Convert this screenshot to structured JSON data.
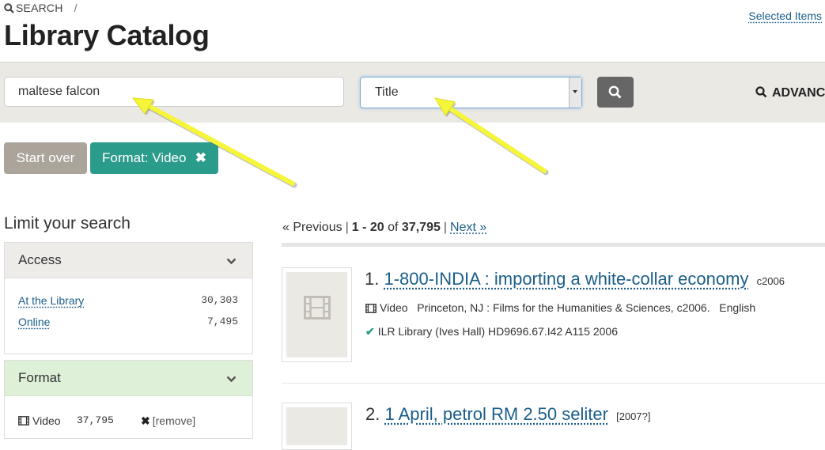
{
  "breadcrumb": {
    "search_label": "SEARCH",
    "separator": "/"
  },
  "header": {
    "selected_items": "Selected Items",
    "title": "Library Catalog"
  },
  "search": {
    "query": "maltese falcon",
    "field": "Title",
    "advanced_label": "ADVANC"
  },
  "constraints": {
    "start_over": "Start over",
    "format_chip": "Format: Video",
    "remove_glyph": "✖"
  },
  "sidebar": {
    "title": "Limit your search",
    "access": {
      "heading": "Access",
      "items": [
        {
          "label": "At the Library",
          "count": "30,303"
        },
        {
          "label": "Online",
          "count": "7,495"
        }
      ]
    },
    "format": {
      "heading": "Format",
      "items": [
        {
          "label": "Video",
          "count": "37,795",
          "remove": "[remove]"
        }
      ]
    }
  },
  "pager": {
    "previous": "« Previous",
    "range": "1 - 20",
    "of": "of",
    "total": "37,795",
    "next": "Next »"
  },
  "results": [
    {
      "number": "1.",
      "title": "1-800-INDIA : importing a white-collar economy",
      "year": "c2006",
      "format": "Video",
      "publisher": "Princeton, NJ : Films for the Humanities & Sciences, c2006.",
      "language": "English",
      "location": "ILR Library (Ives Hall) HD9696.67.I42 A115 2006"
    },
    {
      "number": "2.",
      "title": "1 April, petrol RM 2.50 seliter",
      "year": "[2007?]"
    }
  ],
  "icons": {
    "search": "search-icon",
    "film": "film-icon",
    "check": "check-icon",
    "chevron": "chevron-down-icon",
    "remove": "remove-icon"
  },
  "colors": {
    "link": "#1a5e8a",
    "teal": "#2b9b8c",
    "start_over": "#aaa49b",
    "band": "#ebe9e4",
    "format_facet": "#dff0d8",
    "annotation_arrow": "#f5f53a"
  }
}
